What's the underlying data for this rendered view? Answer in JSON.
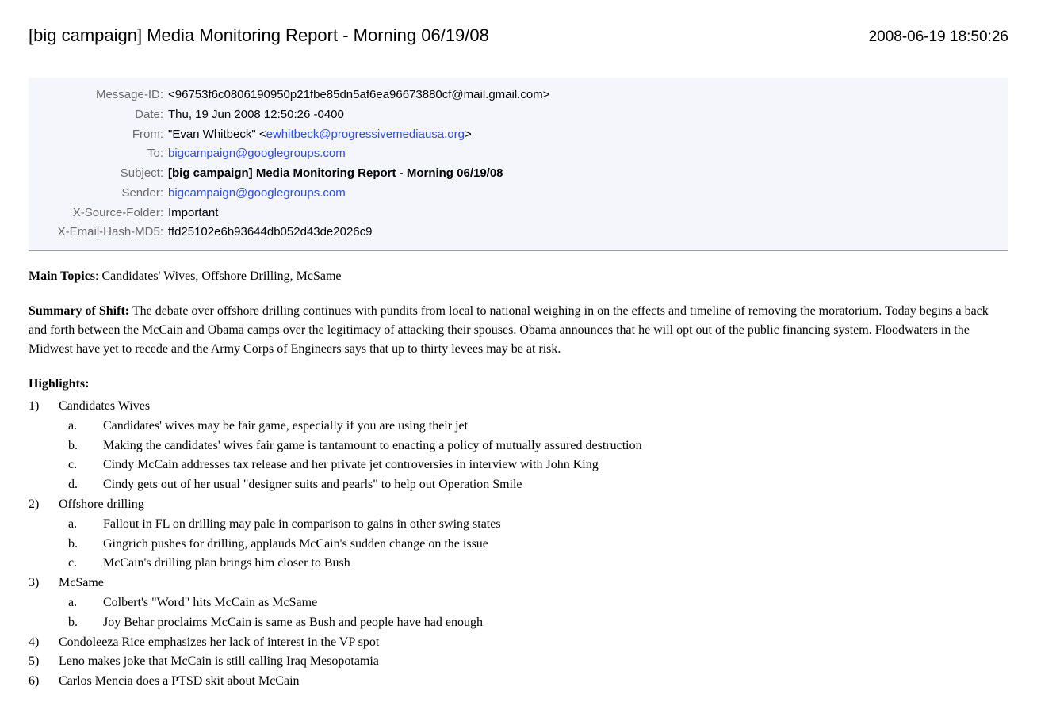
{
  "header": {
    "title": "[big campaign] Media Monitoring Report - Morning 06/19/08",
    "timestamp": "2008-06-19 18:50:26"
  },
  "metadata": {
    "message_id_label": "Message-ID:",
    "message_id_value": "<96753f6c0806190950p21fbe85dn5af6ea96673880cf@mail.gmail.com>",
    "date_label": "Date:",
    "date_value": "Thu, 19 Jun 2008 12:50:26 -0400",
    "from_label": "From:",
    "from_name": "\"Evan Whitbeck\" <",
    "from_email": "ewhitbeck@progressivemediausa.org",
    "from_close": ">",
    "to_label": "To:",
    "to_value": "bigcampaign@googlegroups.com",
    "subject_label": "Subject:",
    "subject_value": "[big campaign] Media Monitoring Report - Morning 06/19/08",
    "sender_label": "Sender:",
    "sender_value": "bigcampaign@googlegroups.com",
    "xsource_label": "X-Source-Folder:",
    "xsource_value": "Important",
    "xhash_label": "X-Email-Hash-MD5:",
    "xhash_value": "ffd25102e6b93644db052d43de2026c9"
  },
  "body": {
    "main_topics_label": "Main Topics",
    "main_topics_value": ": Candidates' Wives, Offshore Drilling, McSame",
    "summary_label": "Summary of Shift:",
    "summary_text": " The debate over offshore drilling continues with pundits from local to national weighing in on the effects and timeline of removing the moratorium. Today begins a back and forth between the McCain and Obama camps over the legitimacy of attacking their spouses. Obama announces that he will opt out of the public financing system. Floodwaters in the Midwest have yet to recede and the Army Corps of Engineers says that up to thirty levees may be at risk.",
    "highlights_label": "Highlights:",
    "highlights": [
      {
        "title": "Candidates Wives",
        "sub": [
          "Candidates' wives may be fair game, especially if you are using their jet",
          "Making the candidates' wives fair game is tantamount to enacting a policy of mutually assured destruction",
          "Cindy McCain addresses tax release and her private jet controversies in interview with John King",
          "Cindy gets out of her usual \"designer suits and pearls\" to help out Operation Smile"
        ]
      },
      {
        "title": "Offshore drilling",
        "sub": [
          "Fallout in FL on drilling may pale in comparison to gains in other swing states",
          "Gingrich pushes for drilling, applauds McCain's sudden change on the issue",
          "McCain's drilling plan brings him closer to Bush"
        ]
      },
      {
        "title": "McSame",
        "sub": [
          "Colbert's \"Word\" hits McCain as McSame",
          "Joy Behar proclaims McCain is same as Bush and people have had enough"
        ]
      },
      {
        "title": "Condoleeza Rice emphasizes her lack of interest in the VP spot",
        "sub": []
      },
      {
        "title": "Leno makes joke that McCain is still calling Iraq Mesopotamia",
        "sub": []
      },
      {
        "title": "Carlos Mencia does a PTSD skit about McCain",
        "sub": []
      }
    ]
  }
}
